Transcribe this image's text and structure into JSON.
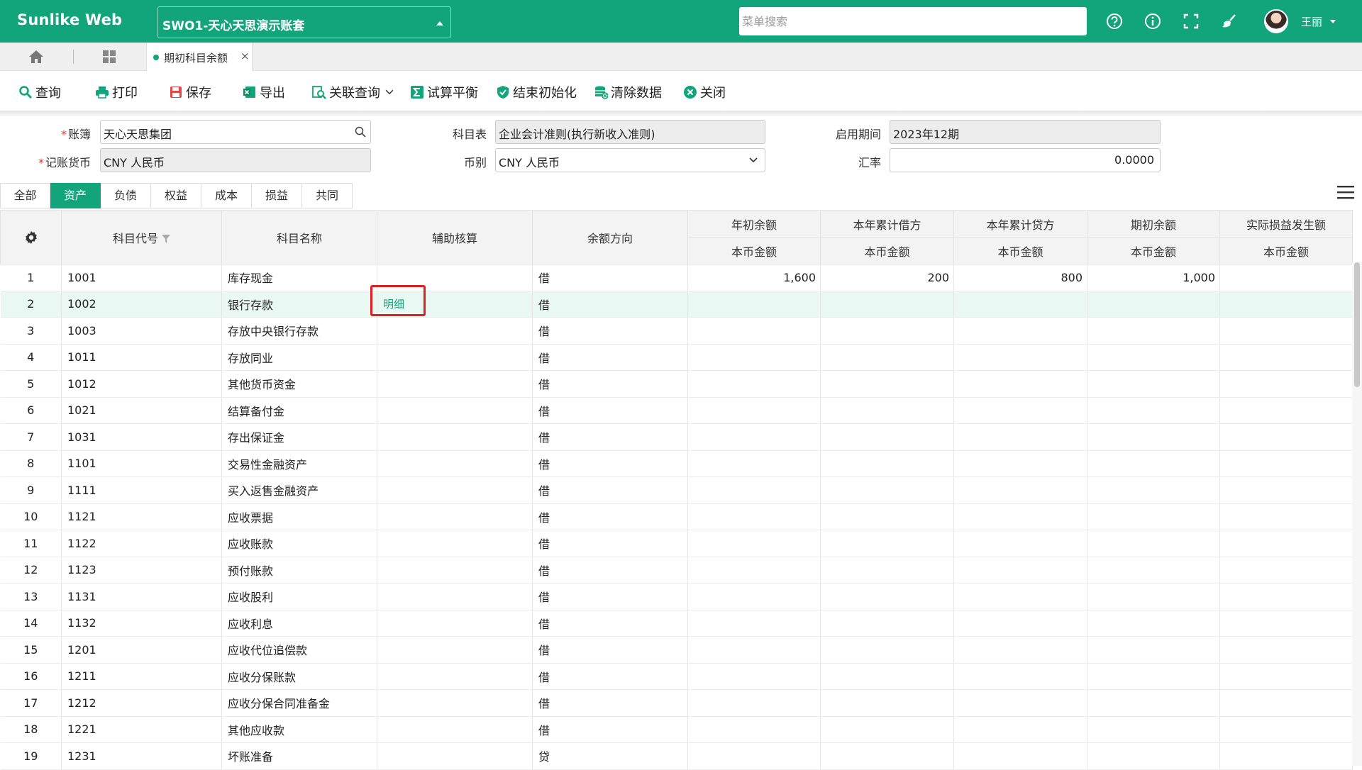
{
  "app": {
    "brand": "Sunlike Web",
    "account_set": "SWO1-天心天思演示账套",
    "menu_search_placeholder": "菜单搜索",
    "user": "王丽"
  },
  "tabs": {
    "active_page": "期初科目余额"
  },
  "toolbar": {
    "query": "查询",
    "print": "打印",
    "save": "保存",
    "export": "导出",
    "linked_query": "关联查询",
    "trial_balance": "试算平衡",
    "end_init": "结束初始化",
    "clear_data": "清除数据",
    "close": "关闭"
  },
  "form": {
    "ledger_label": "账簿",
    "ledger_value": "天心天思集团",
    "chart_label": "科目表",
    "chart_value": "企业会计准则(执行新收入准则)",
    "period_label": "启用期间",
    "period_value": "2023年12期",
    "currency_label": "记账货币",
    "currency_value": "CNY 人民币",
    "coin_label": "币别",
    "coin_value": "CNY 人民币",
    "rate_label": "汇率",
    "rate_value": "0.0000"
  },
  "categories": [
    "全部",
    "资产",
    "负债",
    "权益",
    "成本",
    "损益",
    "共同"
  ],
  "active_category": "资产",
  "grid": {
    "headers": {
      "code": "科目代号",
      "name": "科目名称",
      "aux": "辅助核算",
      "direction": "余额方向",
      "year_opening": "年初余额",
      "ytd_debit": "本年累计借方",
      "ytd_credit": "本年累计贷方",
      "opening": "期初余额",
      "actual_pl": "实际损益发生额",
      "sub": "本币金额"
    },
    "detail_label": "明细",
    "rows": [
      {
        "no": "1",
        "code": "1001",
        "name": "库存现金",
        "dir": "借",
        "year_opening": "1,600",
        "debit": "200",
        "credit": "800",
        "opening": "1,000",
        "pl": ""
      },
      {
        "no": "2",
        "code": "1002",
        "name": "银行存款",
        "dir": "借",
        "year_opening": "",
        "debit": "",
        "credit": "",
        "opening": "",
        "pl": ""
      },
      {
        "no": "3",
        "code": "1003",
        "name": "存放中央银行存款",
        "dir": "借",
        "year_opening": "",
        "debit": "",
        "credit": "",
        "opening": "",
        "pl": ""
      },
      {
        "no": "4",
        "code": "1011",
        "name": "存放同业",
        "dir": "借",
        "year_opening": "",
        "debit": "",
        "credit": "",
        "opening": "",
        "pl": ""
      },
      {
        "no": "5",
        "code": "1012",
        "name": "其他货币资金",
        "dir": "借",
        "year_opening": "",
        "debit": "",
        "credit": "",
        "opening": "",
        "pl": ""
      },
      {
        "no": "6",
        "code": "1021",
        "name": "结算备付金",
        "dir": "借",
        "year_opening": "",
        "debit": "",
        "credit": "",
        "opening": "",
        "pl": ""
      },
      {
        "no": "7",
        "code": "1031",
        "name": "存出保证金",
        "dir": "借",
        "year_opening": "",
        "debit": "",
        "credit": "",
        "opening": "",
        "pl": ""
      },
      {
        "no": "8",
        "code": "1101",
        "name": "交易性金融资产",
        "dir": "借",
        "year_opening": "",
        "debit": "",
        "credit": "",
        "opening": "",
        "pl": ""
      },
      {
        "no": "9",
        "code": "1111",
        "name": "买入返售金融资产",
        "dir": "借",
        "year_opening": "",
        "debit": "",
        "credit": "",
        "opening": "",
        "pl": ""
      },
      {
        "no": "10",
        "code": "1121",
        "name": "应收票据",
        "dir": "借",
        "year_opening": "",
        "debit": "",
        "credit": "",
        "opening": "",
        "pl": ""
      },
      {
        "no": "11",
        "code": "1122",
        "name": "应收账款",
        "dir": "借",
        "year_opening": "",
        "debit": "",
        "credit": "",
        "opening": "",
        "pl": ""
      },
      {
        "no": "12",
        "code": "1123",
        "name": "预付账款",
        "dir": "借",
        "year_opening": "",
        "debit": "",
        "credit": "",
        "opening": "",
        "pl": ""
      },
      {
        "no": "13",
        "code": "1131",
        "name": "应收股利",
        "dir": "借",
        "year_opening": "",
        "debit": "",
        "credit": "",
        "opening": "",
        "pl": ""
      },
      {
        "no": "14",
        "code": "1132",
        "name": "应收利息",
        "dir": "借",
        "year_opening": "",
        "debit": "",
        "credit": "",
        "opening": "",
        "pl": ""
      },
      {
        "no": "15",
        "code": "1201",
        "name": "应收代位追偿款",
        "dir": "借",
        "year_opening": "",
        "debit": "",
        "credit": "",
        "opening": "",
        "pl": ""
      },
      {
        "no": "16",
        "code": "1211",
        "name": "应收分保账款",
        "dir": "借",
        "year_opening": "",
        "debit": "",
        "credit": "",
        "opening": "",
        "pl": ""
      },
      {
        "no": "17",
        "code": "1212",
        "name": "应收分保合同准备金",
        "dir": "借",
        "year_opening": "",
        "debit": "",
        "credit": "",
        "opening": "",
        "pl": ""
      },
      {
        "no": "18",
        "code": "1221",
        "name": "其他应收款",
        "dir": "借",
        "year_opening": "",
        "debit": "",
        "credit": "",
        "opening": "",
        "pl": ""
      },
      {
        "no": "19",
        "code": "1231",
        "name": "坏账准备",
        "dir": "贷",
        "year_opening": "",
        "debit": "",
        "credit": "",
        "opening": "",
        "pl": ""
      }
    ]
  },
  "colors": {
    "brand": "#12a57b",
    "highlight": "#e02020",
    "selected_row": "#eaf8f3"
  }
}
